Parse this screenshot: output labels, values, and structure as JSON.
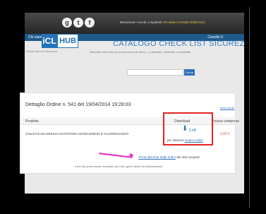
{
  "topbar": {
    "social": [
      "g",
      "t",
      "f"
    ],
    "message": "Benvenuto: Accedi o registrati",
    "links": [
      "Chi siamo",
      "Contatti",
      "Ordini",
      "Esci"
    ]
  },
  "navbar": {
    "left": "Chi siamo | Faq | Pagamento",
    "right": "Carrello 0"
  },
  "logo": {
    "icl": "iCL",
    "hub": "HUB",
    "tagline": "Social Libro di Sicurezza"
  },
  "header": {
    "title": "CATALOGO CHECK LIST SICUREZZA LAVORO",
    "subtitle": "Raccolta check list per la sicurezza del lavoro - pubblicate, verificate e acquistate"
  },
  "search": {
    "placeholder": "",
    "button": "Cerca"
  },
  "order": {
    "title": "Dettaglio Ordine n. 541 del 19/04/2014 19:28:03",
    "account_link": "area utente",
    "columns": [
      "Prodotto",
      "Download",
      "Prezzo compreso"
    ],
    "product": "Check list SICUREZZA ESTINTORI ANTINCENDIO E FLUORESCENTI",
    "download_size": "5 kB",
    "download_note_prefix": "per ottenere",
    "download_note_link": "scarica-salva",
    "price": "0,00 €"
  },
  "message": {
    "link": "Torna alla lista degli ordini",
    "text": " dei miei acquisti",
    "note": "Il tuo file potrà essere scaricato per tutti i giorni della tua sottoscrizione"
  }
}
